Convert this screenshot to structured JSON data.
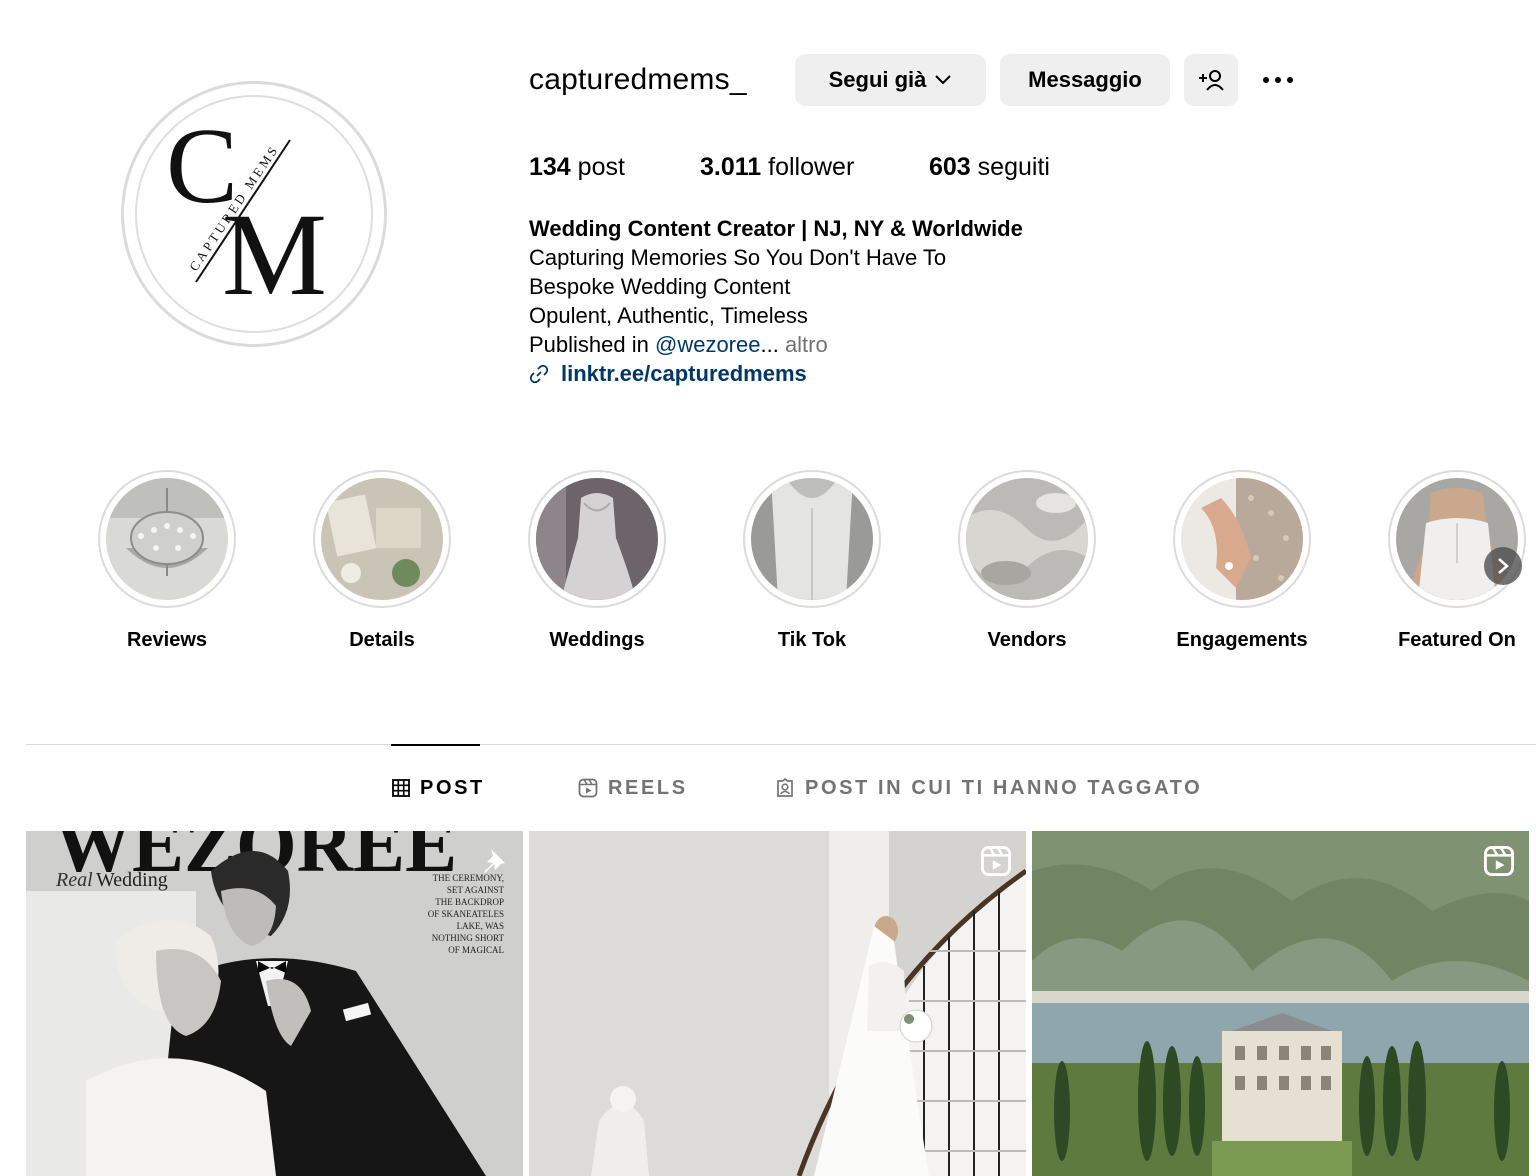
{
  "profile": {
    "username": "capturedmems_",
    "follow_button": "Segui già",
    "message_button": "Messaggio",
    "logo_text": "CAPTURED MEMS",
    "logo_letters": "CM"
  },
  "stats": {
    "posts_count": "134",
    "posts_label": "post",
    "followers_count": "3.011",
    "followers_label": "follower",
    "following_count": "603",
    "following_label": "seguiti"
  },
  "bio": {
    "name": "Wedding Content Creator | NJ, NY & Worldwide",
    "line1": "Capturing Memories So You Don't Have To",
    "line2": "Bespoke Wedding Content",
    "line3": "Opulent, Authentic, Timeless",
    "line4_prefix": "Published in ",
    "line4_mention": "@wezoree",
    "line4_ellipsis": "... ",
    "line4_more": "altro",
    "link": "linktr.ee/capturedmems"
  },
  "highlights": [
    {
      "label": "Reviews",
      "icon": "chandelier-image"
    },
    {
      "label": "Details",
      "icon": "details-flatlay-image"
    },
    {
      "label": "Weddings",
      "icon": "bride-dress-image"
    },
    {
      "label": "Tik Tok",
      "icon": "corset-back-image"
    },
    {
      "label": "Vendors",
      "icon": "vendors-image"
    },
    {
      "label": "Engagements",
      "icon": "ring-hand-image"
    },
    {
      "label": "Featured On",
      "icon": "bride-back-image"
    }
  ],
  "tabs": [
    {
      "label": "POST",
      "icon": "grid-icon",
      "active": true
    },
    {
      "label": "REELS",
      "icon": "reels-icon",
      "active": false
    },
    {
      "label": "POST IN CUI TI HANNO TAGGATO",
      "icon": "tagged-icon",
      "active": false
    }
  ],
  "posts": [
    {
      "kind": "pinned",
      "icon": "pin-icon",
      "magazine_title": "WEZOREE",
      "magazine_script": "Real",
      "magazine_sub": "Wedding",
      "caption_lines": [
        "THE CEREMONY,",
        "SET AGAINST",
        "THE BACKDROP",
        "OF SKANEATELES",
        "LAKE, WAS",
        "NOTHING SHORT",
        "OF MAGICAL"
      ]
    },
    {
      "kind": "reel",
      "icon": "reels-icon",
      "subject": "bride-on-staircase"
    },
    {
      "kind": "reel",
      "icon": "reels-icon",
      "subject": "lake-como-villa"
    }
  ],
  "colors": {
    "button_bg": "#efefef",
    "link": "#00376b",
    "muted": "#737373",
    "border": "#dbdbdb"
  }
}
